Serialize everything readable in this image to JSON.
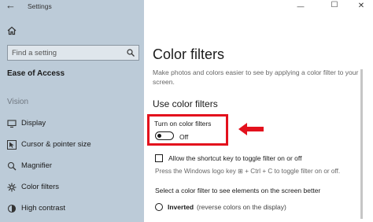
{
  "window": {
    "back_glyph": "←",
    "title": "Settings",
    "minimize_glyph": "—",
    "maximize_glyph": "☐",
    "close_glyph": "✕"
  },
  "sidebar": {
    "home_icon": "home-icon",
    "search_placeholder": "Find a setting",
    "search_icon": "search-icon",
    "section_title": "Ease of Access",
    "group_title": "Vision",
    "items": [
      {
        "label": "Display",
        "icon": "monitor-icon"
      },
      {
        "label": "Cursor & pointer size",
        "icon": "cursor-icon"
      },
      {
        "label": "Magnifier",
        "icon": "magnifier-icon"
      },
      {
        "label": "Color filters",
        "icon": "color-filter-icon"
      },
      {
        "label": "High contrast",
        "icon": "contrast-icon"
      }
    ]
  },
  "main": {
    "title": "Color filters",
    "description": "Make photos and colors easier to see by applying a color filter to your screen.",
    "subheading": "Use color filters",
    "toggle": {
      "label": "Turn on color filters",
      "state": "Off",
      "on": false
    },
    "shortcut_checkbox": {
      "label": "Allow the shortcut key to toggle filter on or off",
      "checked": false
    },
    "shortcut_hint": "Press the Windows logo key ⊞ + Ctrl + C to toggle filter on or off.",
    "select_label": "Select a color filter to see elements on the screen better",
    "radio": {
      "name": "Inverted",
      "desc": "(reverse colors on the display)",
      "selected": false
    }
  },
  "colors": {
    "sidebar_bg": "#bccbd8",
    "highlight": "#e3111d",
    "arrow": "#e3111d"
  }
}
